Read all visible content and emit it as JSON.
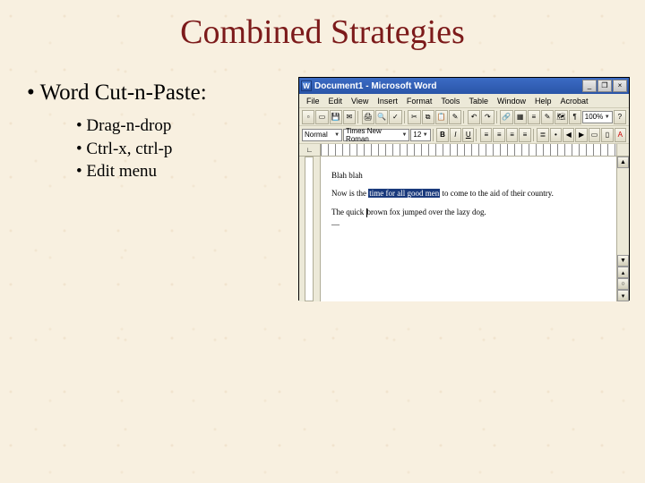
{
  "slide": {
    "title": "Combined Strategies",
    "bullet1": "Word Cut-n-Paste:",
    "sub": [
      "Drag-n-drop",
      "Ctrl-x, ctrl-p",
      "Edit menu"
    ]
  },
  "word": {
    "titlebar": "Document1 - Microsoft Word",
    "icon_letter": "W",
    "winbtns": {
      "min": "_",
      "max": "❐",
      "close": "×"
    },
    "menus": [
      "File",
      "Edit",
      "View",
      "Insert",
      "Format",
      "Tools",
      "Table",
      "Window",
      "Help",
      "Acrobat"
    ],
    "toolbar1_icons": [
      "new-icon",
      "open-icon",
      "save-icon",
      "mail-icon",
      "print-icon",
      "print-preview-icon",
      "spell-icon",
      "cut-icon",
      "copy-icon",
      "paste-icon",
      "format-painter-icon",
      "undo-icon",
      "redo-icon",
      "insert-link-icon",
      "tables-icon",
      "columns-icon",
      "drawing-icon",
      "map-icon",
      "para-icon"
    ],
    "toolbar1_glyphs": [
      "▫",
      "▭",
      "💾",
      "✉",
      "🖨",
      "🔍",
      "✓",
      "✂",
      "⧉",
      "📋",
      "✎",
      "↶",
      "↷",
      "🔗",
      "▦",
      "≡",
      "✎",
      "🗺",
      "¶"
    ],
    "zoom": "100%",
    "style": "Normal",
    "font": "Times New Roman",
    "size": "12",
    "fmt_icons": [
      "bold-icon",
      "italic-icon",
      "underline-icon",
      "align-left-icon",
      "align-center-icon",
      "align-right-icon",
      "justify-icon",
      "numbering-icon",
      "bullets-icon",
      "outdent-icon",
      "indent-icon",
      "border-icon",
      "highlight-icon",
      "font-color-icon"
    ],
    "fmt_glyphs": [
      "B",
      "I",
      "U",
      "≡",
      "≡",
      "≡",
      "≡",
      "≣",
      "•",
      "◀",
      "▶",
      "▭",
      "▯",
      "A"
    ],
    "doc": {
      "line1": "Blah blah",
      "line2a": "Now is the ",
      "line2_sel": "time for all good men",
      "line2b": " to come to the aid of their country.",
      "line3a": "The quick ",
      "line3b": "brown fox jumped over the lazy dog.",
      "line4": "—"
    }
  }
}
